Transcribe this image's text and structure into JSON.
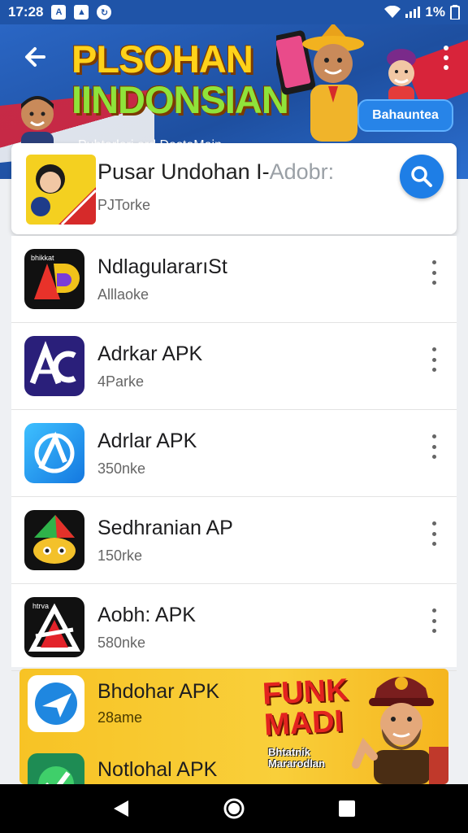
{
  "status_bar": {
    "time": "17:28",
    "battery": "1%"
  },
  "header": {
    "title_line1": "PLSOHAN",
    "title_line2": "IINDONSIAN",
    "subtitle": "Puhtorlari ord DastoMain",
    "button_label": "Bahauntea"
  },
  "search": {
    "query": "Pusar Undohan I-",
    "query_hint": "Adobr:",
    "sub": "PJTorke"
  },
  "apps": [
    {
      "name": "NdlagulararıSt",
      "meta": "Alllaoke",
      "icon": "ap-logo-dark-icon"
    },
    {
      "name": "Adrkar APK",
      "meta": "4Parke",
      "icon": "ac-logo-purple-icon"
    },
    {
      "name": "Adrlar APK",
      "meta": "350nke",
      "icon": "a-logo-blue-icon"
    },
    {
      "name": "Sedhranian AP",
      "meta": "150rke",
      "icon": "green-hat-mascot-icon"
    },
    {
      "name": "Aobh: APK",
      "meta": "580nke",
      "icon": "a-logo-red-icon"
    }
  ],
  "promo": {
    "items": [
      {
        "name": "Bhdohar APK",
        "meta": "28ame",
        "icon": "plane-logo-blue-icon"
      },
      {
        "name": "Notlohal APK",
        "meta": "",
        "icon": "check-logo-green-icon"
      }
    ],
    "title_line1": "FUNK",
    "title_line2": "MADI",
    "caption_line1": "Bhtatnik",
    "caption_line2": "Mararodlan"
  },
  "colors": {
    "header_blue": "#1f54a8",
    "accent_blue": "#1e7ee6",
    "promo_yellow": "#f7c325",
    "title_yellow": "#ffd21a"
  }
}
